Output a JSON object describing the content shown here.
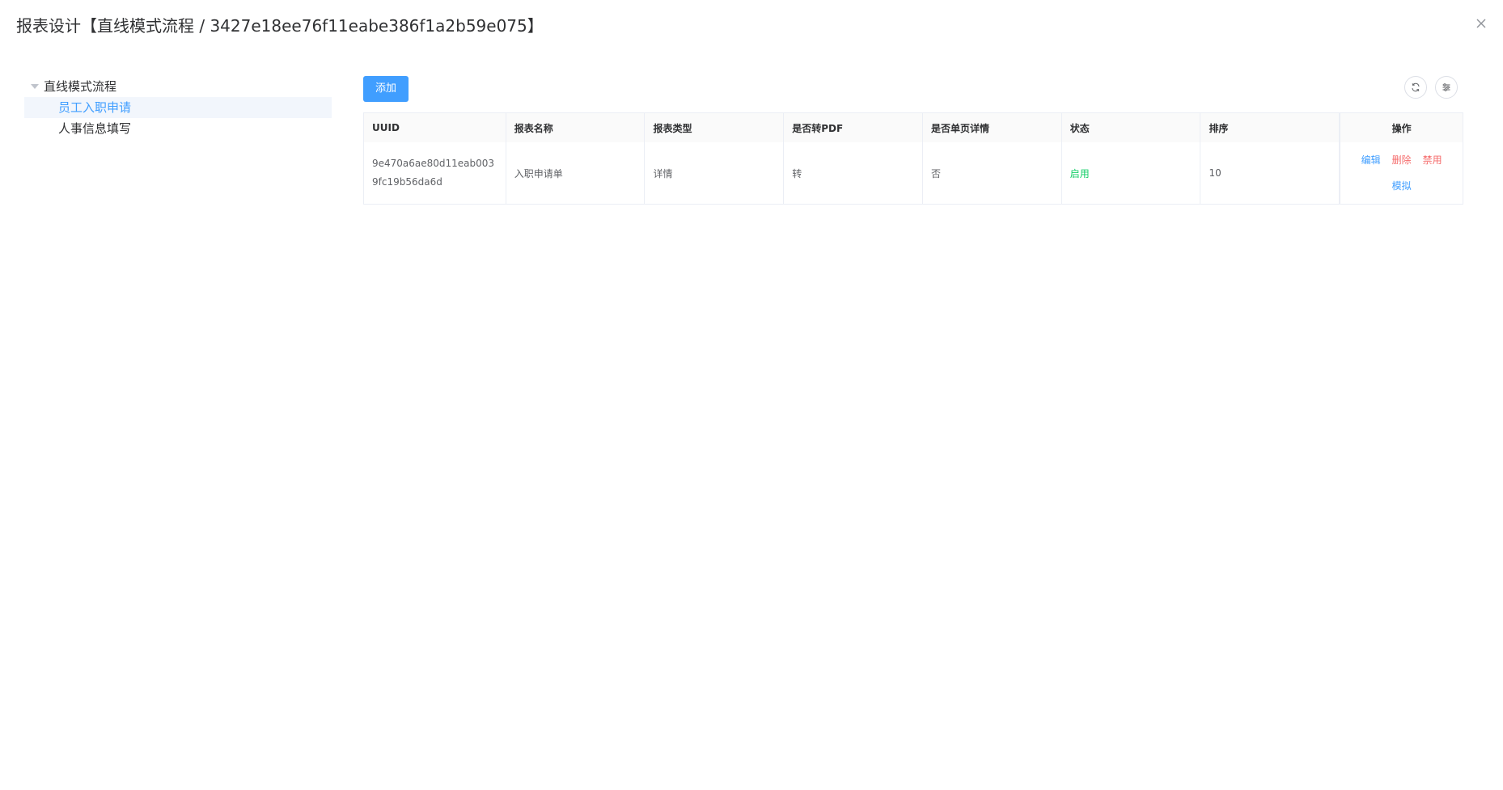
{
  "dialog": {
    "title": "报表设计【直线模式流程 / 3427e18ee76f11eabe386f1a2b59e075】"
  },
  "tree": {
    "root_label": "直线模式流程",
    "children": [
      {
        "label": "员工入职申请",
        "selected": true
      },
      {
        "label": "人事信息填写",
        "selected": false
      }
    ]
  },
  "toolbar": {
    "add_label": "添加",
    "refresh_icon": "refresh-icon",
    "columns_icon": "column-settings-icon"
  },
  "table": {
    "headers": {
      "uuid": "UUID",
      "name": "报表名称",
      "type": "报表类型",
      "pdf": "是否转PDF",
      "single": "是否单页详情",
      "status": "状态",
      "order": "排序",
      "ops": "操作"
    },
    "rows": [
      {
        "uuid": "9e470a6ae80d11eab0039fc19b56da6d",
        "name": "入职申请单",
        "type": "详情",
        "pdf": "转",
        "single": "否",
        "status": "启用",
        "order": "10",
        "ops": {
          "edit": "编辑",
          "delete": "删除",
          "disable": "禁用",
          "simulate": "模拟"
        }
      }
    ]
  },
  "colors": {
    "primary": "#409eff",
    "danger": "#f56c6c",
    "success": "#13ce66"
  }
}
